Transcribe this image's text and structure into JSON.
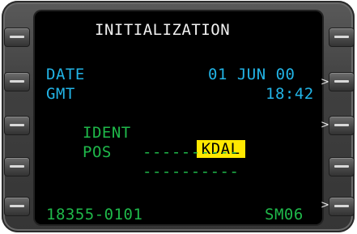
{
  "title": "INITIALIZATION",
  "fields": {
    "date_label": "DATE",
    "date_value": "01 JUN 00",
    "gmt_label": "GMT",
    "gmt_value": "18:42",
    "ident_label": "IDENT",
    "ident_value": "KDAL",
    "pos_label": "POS",
    "pos_line1": "----------",
    "pos_line2": "----------"
  },
  "footer": {
    "left": "18355-0101",
    "right": "SM06"
  },
  "carets": {
    "r2": ">",
    "r3": ">",
    "r5": ">"
  },
  "colors": {
    "title": "#f2f2f2",
    "data_labels": "#22b4e6",
    "ident_pos": "#1fb84a",
    "highlight_bg": "#ffe800"
  }
}
